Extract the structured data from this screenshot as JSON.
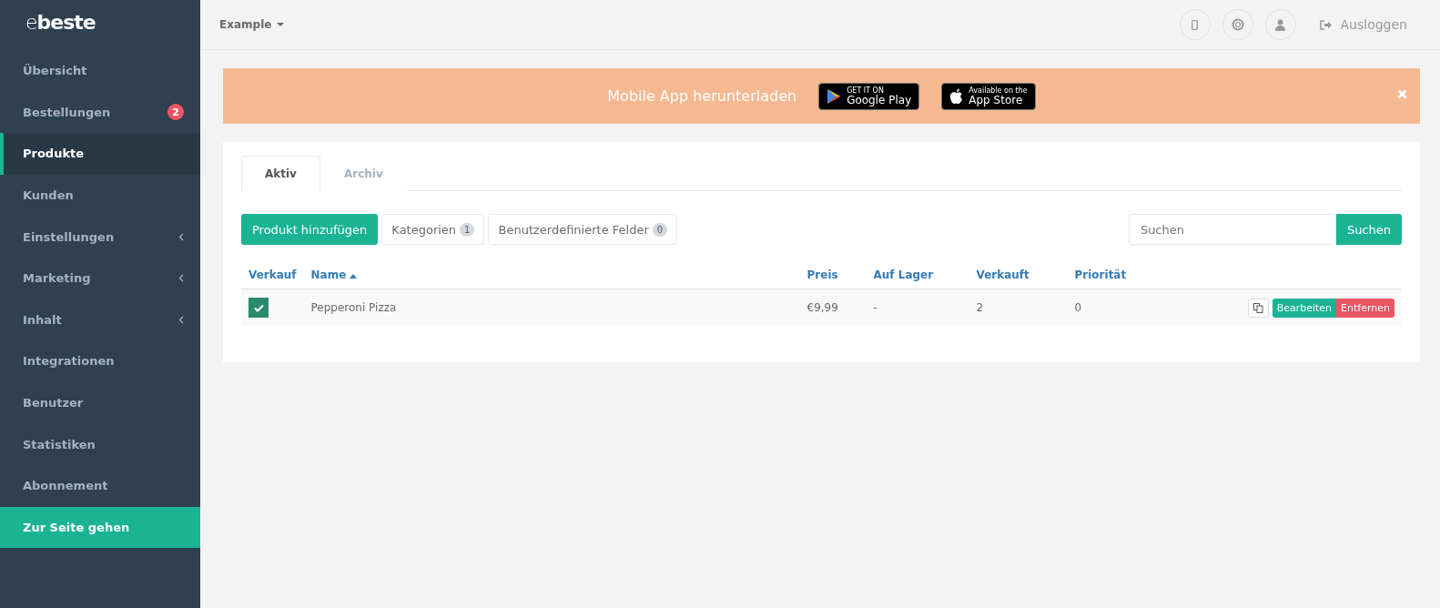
{
  "logo": {
    "light": "e",
    "bold": "beste"
  },
  "sidebar": {
    "items": [
      {
        "label": "Übersicht",
        "selected": false,
        "kind": "plain"
      },
      {
        "label": "Bestellungen",
        "selected": false,
        "kind": "plain",
        "badge": "2"
      },
      {
        "label": "Produkte",
        "selected": true,
        "kind": "plain"
      },
      {
        "label": "Kunden",
        "selected": false,
        "kind": "plain"
      },
      {
        "label": "Einstellungen",
        "selected": false,
        "kind": "expandable"
      },
      {
        "label": "Marketing",
        "selected": false,
        "kind": "expandable"
      },
      {
        "label": "Inhalt",
        "selected": false,
        "kind": "expandable"
      },
      {
        "label": "Integrationen",
        "selected": false,
        "kind": "plain"
      },
      {
        "label": "Benutzer",
        "selected": false,
        "kind": "plain"
      },
      {
        "label": "Statistiken",
        "selected": false,
        "kind": "plain"
      },
      {
        "label": "Abonnement",
        "selected": false,
        "kind": "plain"
      },
      {
        "label": "Zur Seite gehen",
        "selected": false,
        "kind": "highlight"
      }
    ]
  },
  "topbar": {
    "shop": "Example",
    "logout": "Ausloggen"
  },
  "banner": {
    "text": "Mobile App herunterladen",
    "stores": [
      {
        "kind": "google",
        "small": "GET IT ON",
        "big": "Google Play"
      },
      {
        "kind": "apple",
        "small": "Available on the",
        "big": "App Store"
      }
    ]
  },
  "tabs": [
    {
      "label": "Aktiv",
      "selected": true
    },
    {
      "label": "Archiv",
      "selected": false
    }
  ],
  "toolbar": {
    "add": "Produkt hinzufügen",
    "buttons": [
      {
        "label": "Kategorien",
        "count": "1"
      },
      {
        "label": "Benutzerdefinierte Felder",
        "count": "0"
      }
    ],
    "search": {
      "placeholder": "Suchen",
      "button": "Suchen"
    }
  },
  "table": {
    "columns": [
      {
        "label": "Verkauf",
        "sorted": false
      },
      {
        "label": "Name",
        "sorted": true
      },
      {
        "label": "Preis",
        "sorted": false
      },
      {
        "label": "Auf Lager",
        "sorted": false
      },
      {
        "label": "Verkauft",
        "sorted": false
      },
      {
        "label": "Priorität",
        "sorted": false
      }
    ],
    "rows": [
      {
        "checked": true,
        "name": "Pepperoni Pizza",
        "price": "€9,99",
        "stock": "-",
        "sold": "2",
        "priority": "0",
        "edit": "Bearbeiten",
        "remove": "Entfernen"
      }
    ]
  }
}
